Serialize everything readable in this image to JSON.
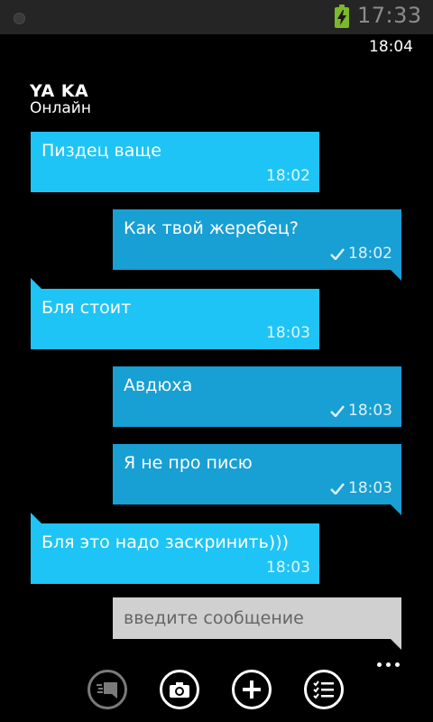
{
  "status_bar": {
    "time": "17:33"
  },
  "app_clock": "18:04",
  "contact": {
    "name": "YA KA",
    "status": "Онлайн"
  },
  "messages": [
    {
      "direction": "incoming",
      "text": "Пиздец ваще",
      "time": "18:02"
    },
    {
      "direction": "outgoing",
      "text": "Как твой жеребец?",
      "time": "18:02",
      "delivered": true
    },
    {
      "direction": "incoming",
      "text": "Бля стоит",
      "time": "18:03"
    },
    {
      "direction": "outgoing",
      "text": "Авдюха",
      "time": "18:03",
      "delivered": true
    },
    {
      "direction": "outgoing",
      "text": "Я не про писю",
      "time": "18:03",
      "delivered": true
    },
    {
      "direction": "incoming",
      "text": "Бля это надо заскринить)))",
      "time": "18:03"
    }
  ],
  "composer": {
    "placeholder": "введите сообщение"
  },
  "app_bar": {
    "buttons": [
      {
        "icon": "chat-list-icon",
        "enabled": false
      },
      {
        "icon": "camera-icon",
        "enabled": true
      },
      {
        "icon": "plus-icon",
        "enabled": true
      },
      {
        "icon": "checklist-icon",
        "enabled": true
      }
    ]
  },
  "colors": {
    "incoming_bubble": "#1ec4f5",
    "outgoing_bubble": "#189fd4",
    "input_background": "#d0d0d0",
    "battery": "#7cb82a",
    "background": "#000000"
  }
}
